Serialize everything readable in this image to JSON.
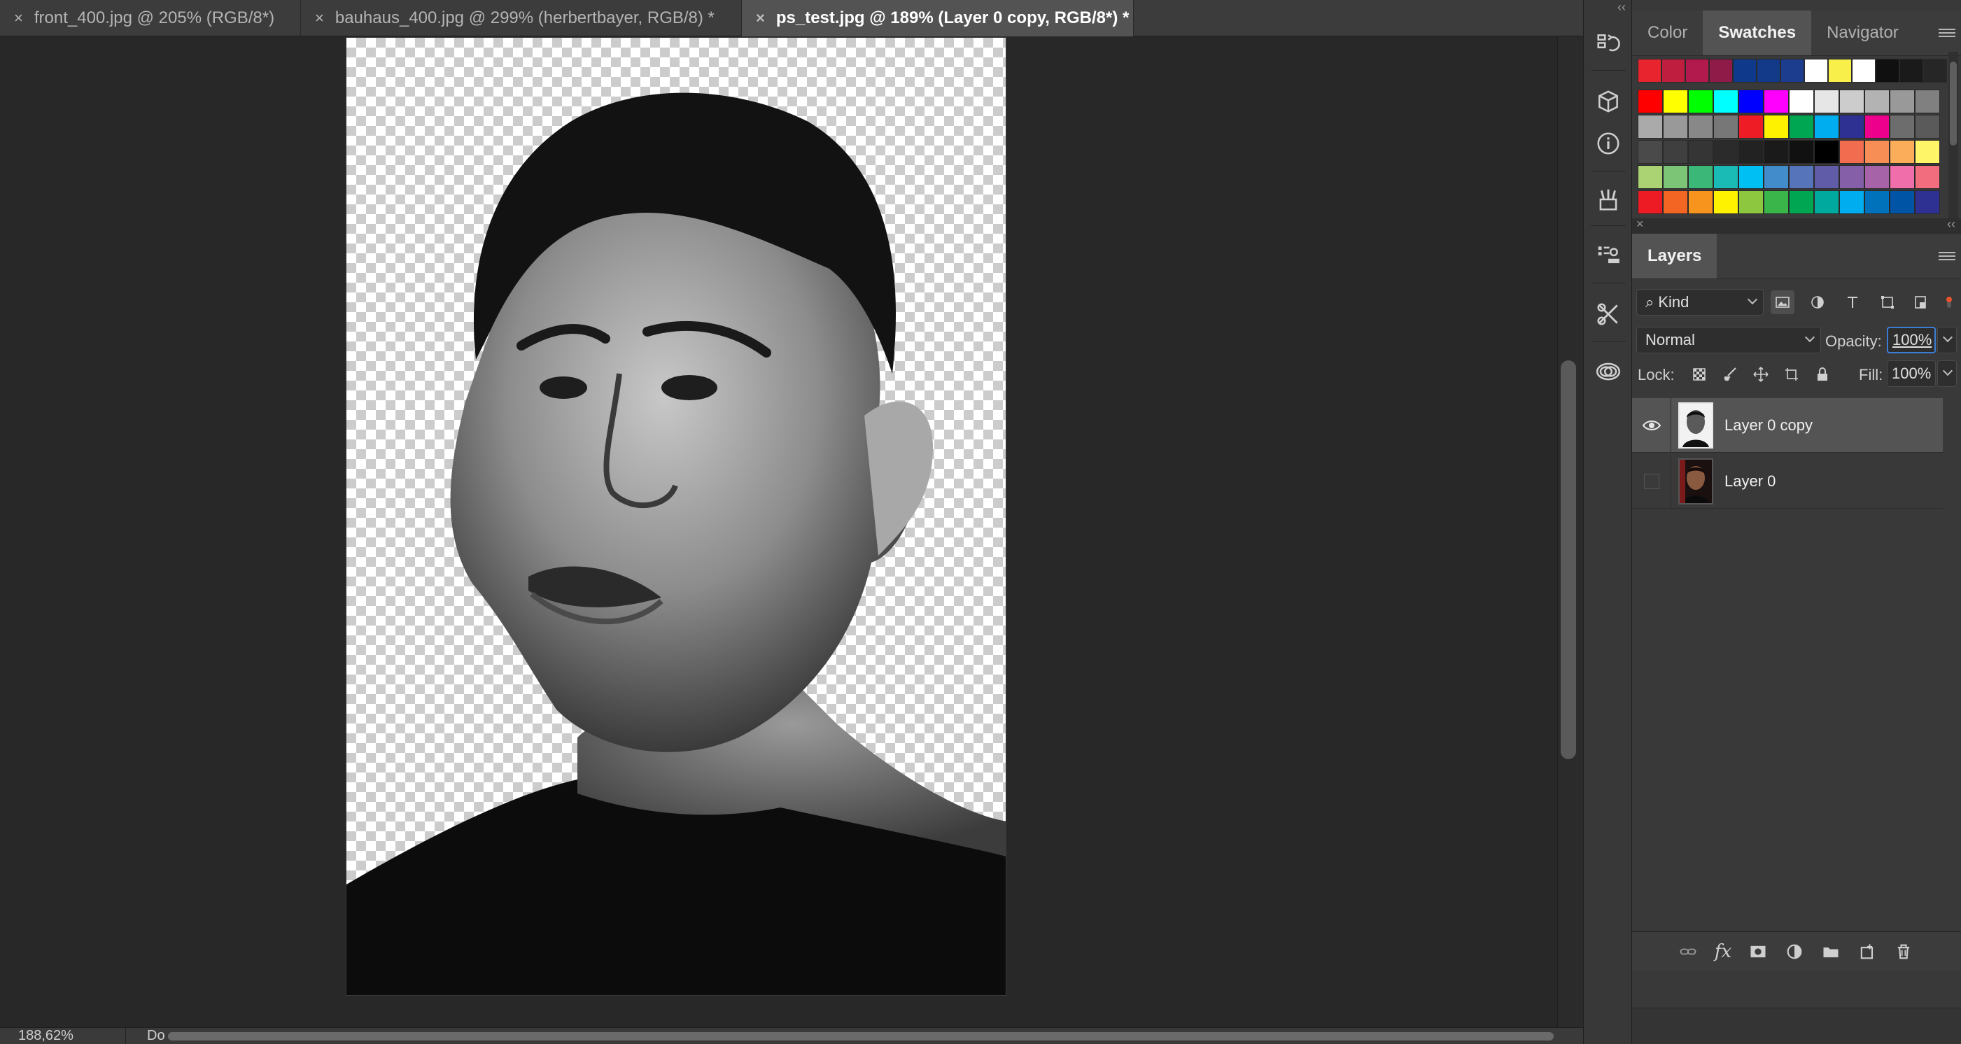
{
  "tabs": [
    {
      "close": "×",
      "label": "front_400.jpg @ 205% (RGB/8*)",
      "active": false
    },
    {
      "close": "×",
      "label": "bauhaus_400.jpg @ 299% (herbertbayer, RGB/8) *",
      "active": false
    },
    {
      "close": "×",
      "label": "ps_test.jpg @ 189% (Layer 0 copy, RGB/8*) *",
      "active": true
    }
  ],
  "status": {
    "zoom": "188,62%",
    "doc_info": "Do"
  },
  "dock": {
    "collapse_label": "‹‹",
    "icons": [
      "history-icon",
      "3d-icon",
      "info-icon",
      "brush-presets-icon",
      "clone-source-icon",
      "tool-presets-icon",
      "libraries-icon"
    ]
  },
  "swatches_panel": {
    "tabs": [
      "Color",
      "Swatches",
      "Navigator"
    ],
    "active_tab": "Swatches",
    "rows": [
      [
        "#e8242f",
        "#c01e3e",
        "#b21a4e",
        "#8e1b48",
        "#0f3a8c",
        "#123a88",
        "#1c3c8e",
        "#ffffff",
        "#f8ef4a",
        "#ffffff",
        "#101010",
        "#1a1a1a",
        "#262626"
      ],
      [
        "#ff0000",
        "#ffff00",
        "#00ff00",
        "#00ffff",
        "#0000ff",
        "#ff00ff",
        "#ffffff",
        "#e6e6e6",
        "#cccccc",
        "#b3b3b3",
        "#999999",
        "#808080"
      ],
      [
        "#aaaaaa",
        "#999999",
        "#888888",
        "#777777",
        "#ee1c24",
        "#fff200",
        "#00a651",
        "#00aeef",
        "#2e3192",
        "#ec008c",
        "#6d6d6d",
        "#5a5a5a"
      ],
      [
        "#4a4a4a",
        "#3f3f3f",
        "#353535",
        "#2b2b2b",
        "#222222",
        "#1a1a1a",
        "#111111",
        "#000000",
        "#f26c4f",
        "#f68e55",
        "#fbad59",
        "#fff568"
      ],
      [
        "#acd373",
        "#7cc576",
        "#3bb878",
        "#1abbb4",
        "#00bff3",
        "#438ccb",
        "#5574b9",
        "#605ca8",
        "#8560a8",
        "#a763a8",
        "#f06ea9",
        "#f26d7d"
      ],
      [
        "#ed1c24",
        "#f26522",
        "#f7941d",
        "#fff200",
        "#8dc63f",
        "#39b54a",
        "#00a651",
        "#00a99d",
        "#00aeef",
        "#0072bc",
        "#0054a6",
        "#2e3192"
      ]
    ]
  },
  "layers_panel": {
    "close_label": "×",
    "collapse_label": "‹‹",
    "title": "Layers",
    "filter": {
      "label": "Kind",
      "icons": [
        "pixel-filter-icon",
        "adjustment-filter-icon",
        "type-filter-icon",
        "shape-filter-icon",
        "smart-object-filter-icon",
        "filter-toggle-icon"
      ]
    },
    "blend_mode": "Normal",
    "opacity_label": "Opacity:",
    "opacity": "100%",
    "lock_label": "Lock:",
    "fill_label": "Fill:",
    "fill": "100%",
    "layers": [
      {
        "name": "Layer 0 copy",
        "visible": true,
        "selected": true,
        "thumb": "grayscale"
      },
      {
        "name": "Layer 0",
        "visible": false,
        "selected": false,
        "thumb": "color"
      }
    ],
    "footer_icons": [
      "link-layers-icon",
      "fx-icon",
      "add-mask-icon",
      "adjustment-layer-icon",
      "new-group-icon",
      "new-layer-icon",
      "delete-layer-icon"
    ],
    "fx_label": "fx"
  },
  "colors": {
    "accent_opacity_border": "#3c7ed6",
    "visibility_dot": "#e8522d"
  }
}
